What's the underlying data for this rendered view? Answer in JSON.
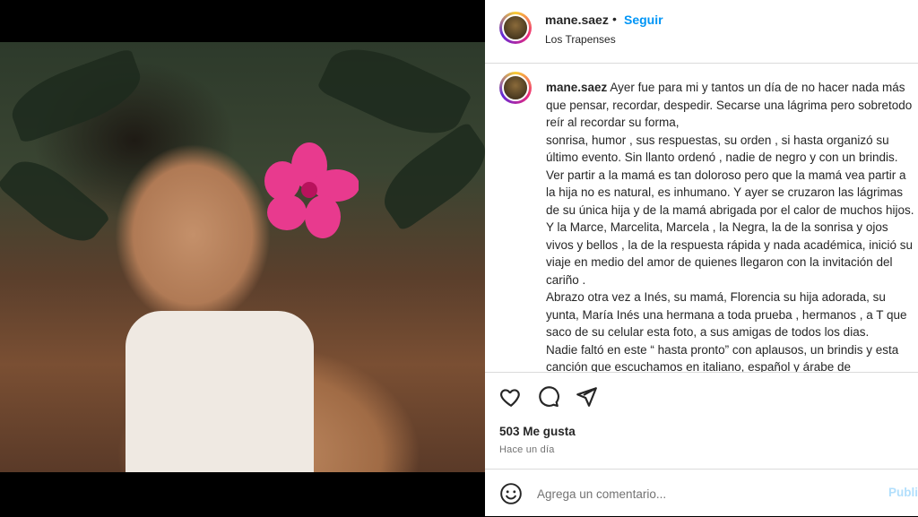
{
  "post": {
    "username": "mane.saez",
    "separator": "•",
    "follow_label": "Seguir",
    "location": "Los Trapenses",
    "caption": "Ayer fue para mi y tantos un día de no hacer nada más que pensar, recordar, despedir. Secarse una lágrima pero sobretodo reír al recordar su forma,\nsonrisa, humor , sus respuestas, su orden , si hasta organizó su último evento. Sin llanto ordenó , nadie de negro y con un brindis. Ver partir a la mamá es tan doloroso pero que la mamá vea partir a la hija no es natural, es inhumano. Y ayer se cruzaron las lágrimas de su única hija y de la mamá abrigada por el calor de muchos hijos.\nY la Marce, Marcelita, Marcela , la Negra, la de la sonrisa y ojos vivos y bellos , la de la respuesta rápida y nada académica, inició su viaje en medio del amor de quienes llegaron con la invitación del cariño .\nAbrazo otra vez a Inés, su mamá, Florencia su hija adorada, su yunta, María Inés una hermana a toda prueba , hermanos , a T que saco de su celular esta foto, a sus amigas de todos los dias.\nNadie faltó en este “ hasta pronto” con aplausos, un brindis y esta canción que escuchamos en italiano, español y árabe de",
    "likes": "503 Me gusta",
    "time_ago": "Hace un día",
    "comment_placeholder": "Agrega un comentario...",
    "publish_label": "Publicar"
  },
  "icons": {
    "like": "heart-icon",
    "comment": "comment-icon",
    "share": "share-icon",
    "emoji": "emoji-icon"
  },
  "colors": {
    "accent": "#0095f6",
    "publish_disabled": "#b2dffc",
    "text": "#262626",
    "muted": "#737373"
  }
}
